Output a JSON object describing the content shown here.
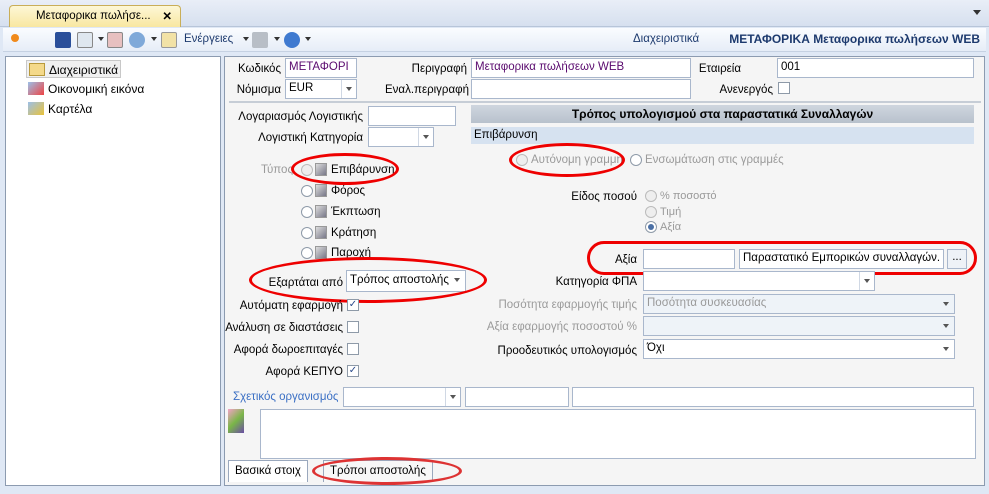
{
  "window": {
    "tab_title": "Μεταφορικα πωλήσε...",
    "close": "✕"
  },
  "toolbar": {
    "actions_label": "Ενέργειες",
    "section": "Διαχειριστικά",
    "record_title": "ΜΕΤΑΦΟΡΙΚΑ Μεταφορικα πωλήσεων WEB"
  },
  "sidebar": {
    "items": [
      {
        "label": "Διαχειριστικά"
      },
      {
        "label": "Οικονομική εικόνα"
      },
      {
        "label": "Καρτέλα"
      }
    ]
  },
  "form": {
    "code_label": "Κωδικός",
    "code": "ΜΕΤΑΦΟΡΙ",
    "desc_label": "Περιγραφή",
    "desc": "Μεταφορικα πωλήσεων WEB",
    "company_label": "Εταιρεία",
    "company": "001",
    "currency_label": "Νόμισμα",
    "currency": "EUR",
    "alt_desc_label": "Εναλ.περιγραφή",
    "alt_desc": "",
    "inactive_label": "Ανενεργός",
    "account_label": "Λογαριασμός Λογιστικής",
    "acc_cat_label": "Λογιστική Κατηγορία",
    "calc_header": "Τρόπος υπολογισμού στα παραστατικά Συναλλαγών",
    "calc_sub": "Επιβάρυνση",
    "type_label": "Τύπος",
    "types": [
      "Επιβάρυνση",
      "Φόρος",
      "Έκπτωση",
      "Κράτηση",
      "Παροχή"
    ],
    "line_options": [
      "Αυτόνομη γραμμή",
      "Ενσωμάτωση στις γραμμές"
    ],
    "amount_kind_label": "Είδος ποσού",
    "amount_kinds": [
      "% ποσοστό",
      "Τιμή",
      "Αξία"
    ],
    "depends_label": "Εξαρτάται από",
    "depends": "Τρόπος αποστολής",
    "value_label": "Αξία",
    "value": "",
    "value_doc": "Παραστατικό Εμπορικών συναλλαγών.",
    "ellipsis": "...",
    "vat_label": "Κατηγορία ΦΠΑ",
    "auto_label": "Αυτόματη εφαρμογή",
    "dims_label": "Ανάλυση σε διαστάσεις",
    "gifts_label": "Αφορά δωροεπιταγές",
    "kepyo_label": "Αφορά ΚΕΠΥΟ",
    "qty_price_label": "Ποσότητα εφαρμογής τιμής",
    "qty_price": "Ποσότητα συσκευασίας",
    "pct_value_label": "Αξία εφαρμογής ποσοστού %",
    "progressive_label": "Προοδευτικός υπολογισμός",
    "progressive": "Όχι",
    "org_label": "Σχετικός οργανισμός"
  },
  "bottom_tabs": [
    "Βασικά στοιχ",
    "Τρόποι αποστολής"
  ]
}
